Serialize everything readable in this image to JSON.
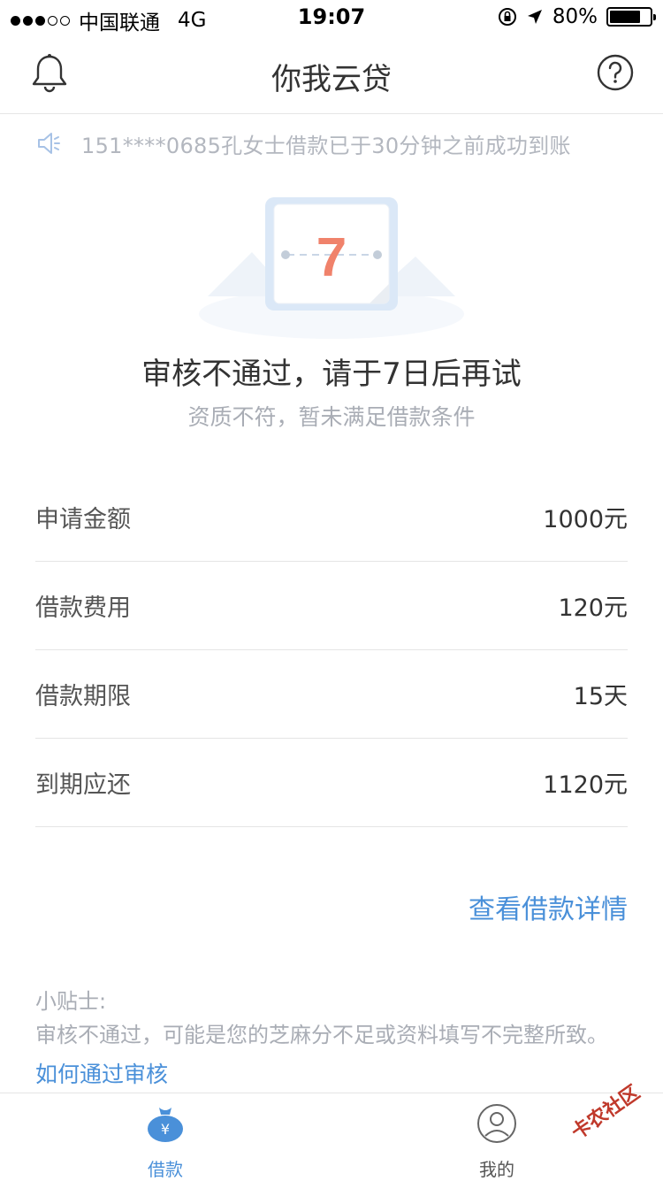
{
  "status_bar": {
    "carrier": "中国联通",
    "network": "4G",
    "time": "19:07",
    "battery": "80%",
    "battery_level": 0.8
  },
  "nav": {
    "title": "你我云贷"
  },
  "notice": {
    "text": "151****0685孔女士借款已于30分钟之前成功到账"
  },
  "illustration": {
    "day_number": "7"
  },
  "result": {
    "title": "审核不通过，请于7日后再试",
    "subtitle": "资质不符，暂未满足借款条件"
  },
  "details": [
    {
      "label": "申请金额",
      "value": "1000元"
    },
    {
      "label": "借款费用",
      "value": "120元"
    },
    {
      "label": "借款期限",
      "value": "15天"
    },
    {
      "label": "到期应还",
      "value": "1120元"
    }
  ],
  "detail_link": "查看借款详情",
  "tips": {
    "title": "小贴士:",
    "text": "审核不通过，可能是您的芝麻分不足或资料填写不完整所致。",
    "link": "如何通过审核"
  },
  "tabs": [
    {
      "label": "借款",
      "icon": "money-bag-icon",
      "active": true
    },
    {
      "label": "我的",
      "icon": "user-icon",
      "active": false
    }
  ],
  "watermark": "卡农社区",
  "colors": {
    "accent": "#4a90d9",
    "highlight": "#f0826b"
  }
}
